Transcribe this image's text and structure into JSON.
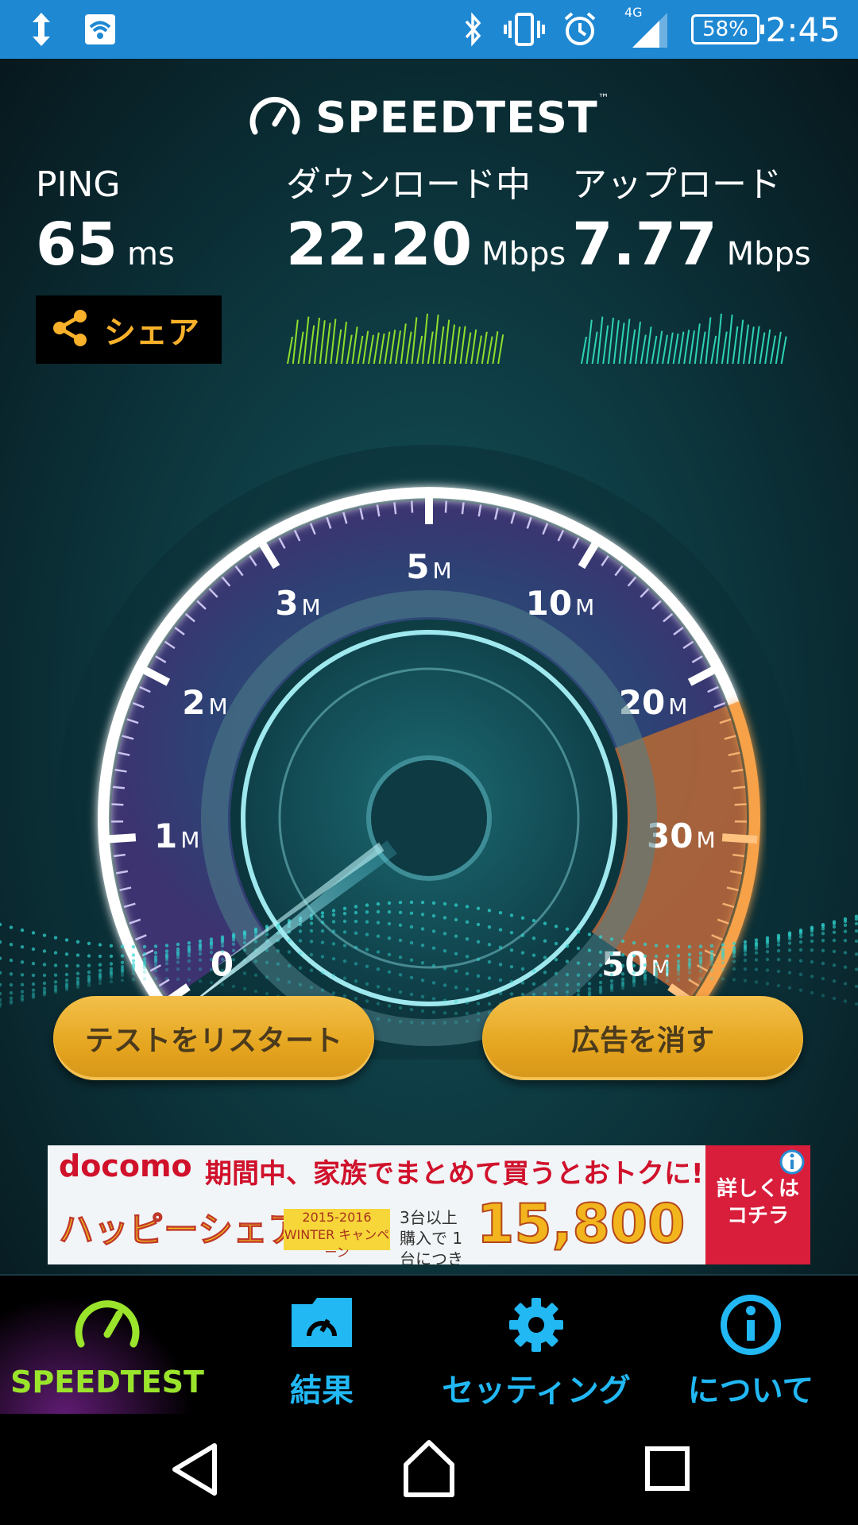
{
  "status_bar": {
    "time": "2:45",
    "battery": "58%",
    "network": "4G",
    "icons": [
      "data-transfer-icon",
      "wifi-signal-icon",
      "bluetooth-icon",
      "vibrate-icon",
      "alarm-icon",
      "cell-signal-icon",
      "battery-icon"
    ]
  },
  "header": {
    "title": "SPEEDTEST",
    "tm": "™",
    "icon": "speedometer-icon"
  },
  "ping": {
    "label": "PING",
    "value": "65",
    "unit": "ms"
  },
  "download": {
    "label": "ダウンロード中",
    "value": "22.20",
    "unit": "Mbps"
  },
  "upload": {
    "label": "アップロード",
    "value": "7.77",
    "unit": "Mbps"
  },
  "share": {
    "label": "シェア",
    "icon": "share-icon"
  },
  "gauge": {
    "scale_labels": [
      {
        "num": "0",
        "unit": ""
      },
      {
        "num": "1",
        "unit": "M"
      },
      {
        "num": "2",
        "unit": "M"
      },
      {
        "num": "3",
        "unit": "M"
      },
      {
        "num": "5",
        "unit": "M"
      },
      {
        "num": "10",
        "unit": "M"
      },
      {
        "num": "20",
        "unit": "M"
      },
      {
        "num": "30",
        "unit": "M"
      },
      {
        "num": "50",
        "unit": "M"
      }
    ],
    "current_value_mbps": 22.2
  },
  "buttons": {
    "restart": "テストをリスタート",
    "remove_ads": "広告を消す"
  },
  "ad": {
    "brand": "docomo",
    "headline": "期間中、家族でまとめて買うとおトクに!!",
    "left_text": "ハッピーシェア♪",
    "campaign": "2015-2016 WINTER キャンペーン",
    "sub": "3台以上 購入で 1台につき",
    "price": "15,800",
    "cta": "詳しくは コチラ",
    "info_icon": "info-icon"
  },
  "tabs": [
    {
      "label": "SPEEDTEST",
      "icon": "speedometer-icon",
      "active": true
    },
    {
      "label": "結果",
      "icon": "folder-icon",
      "active": false
    },
    {
      "label": "セッティング",
      "icon": "gear-icon",
      "active": false
    },
    {
      "label": "について",
      "icon": "info-icon",
      "active": false
    }
  ],
  "nav": [
    "back-icon",
    "home-icon",
    "recents-icon"
  ],
  "colors": {
    "status_bar": "#1e88d3",
    "accent_green": "#9ae42c",
    "accent_blue": "#21b8f4",
    "button_gold": "#e5a51f",
    "gauge_orange": "#f08a2b"
  }
}
